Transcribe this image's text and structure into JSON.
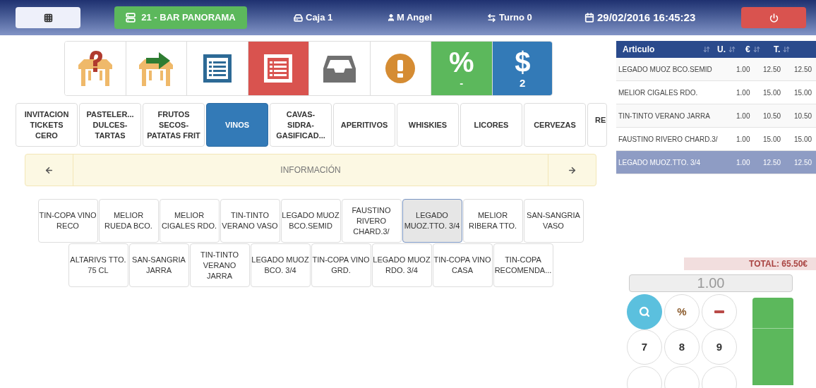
{
  "header": {
    "location": "21 - BAR PANORAMA",
    "register": "Caja 1",
    "user": "M Angel",
    "shift": "Turno 0",
    "datetime": "29/02/2016 16:45:23"
  },
  "toolbar": [
    {
      "kind": "table-question"
    },
    {
      "kind": "table-move"
    },
    {
      "kind": "list"
    },
    {
      "kind": "list-red"
    },
    {
      "kind": "tray"
    },
    {
      "kind": "warning"
    },
    {
      "kind": "discount",
      "label": "%",
      "caption": "-"
    },
    {
      "kind": "payment",
      "label": "$",
      "caption": "2"
    }
  ],
  "categories": [
    {
      "label": "INVITACION TICKETS CERO",
      "selected": false
    },
    {
      "label": "PASTELER... DULCES-TARTAS",
      "selected": false
    },
    {
      "label": "FRUTOS SECOS-PATATAS FRIT",
      "selected": false
    },
    {
      "label": "VINOS",
      "selected": true
    },
    {
      "label": "CAVAS-SIDRA-GASIFICAD...",
      "selected": false
    },
    {
      "label": "APERITIVOS",
      "selected": false
    },
    {
      "label": "WHISKIES",
      "selected": false
    },
    {
      "label": "LICORES",
      "selected": false
    },
    {
      "label": "CERVEZAS",
      "selected": false
    },
    {
      "label": "RE",
      "selected": false,
      "clipped": true
    }
  ],
  "info": {
    "label": "INFORMACIÓN"
  },
  "products": [
    [
      {
        "label": "TIN-COPA VINO RECO",
        "selected": false
      },
      {
        "label": "MELIOR RUEDA BCO.",
        "selected": false
      },
      {
        "label": "MELIOR CIGALES RDO.",
        "selected": false
      },
      {
        "label": "TIN-TINTO VERANO VASO",
        "selected": false
      },
      {
        "label": "LEGADO MUOZ BCO.SEMID",
        "selected": false
      },
      {
        "label": "FAUSTINO RIVERO CHARD.3/",
        "selected": false
      },
      {
        "label": "LEGADO MUOZ.TTO. 3/4",
        "selected": true
      },
      {
        "label": "MELIOR RIBERA TTO.",
        "selected": false
      },
      {
        "label": "SAN-SANGRIA VASO",
        "selected": false
      }
    ],
    [
      {
        "label": "ALTARIVS TTO. 75 CL",
        "selected": false
      },
      {
        "label": "SAN-SANGRIA JARRA",
        "selected": false
      },
      {
        "label": "TIN-TINTO VERANO JARRA",
        "selected": false
      },
      {
        "label": "LEGADO MUOZ BCO. 3/4",
        "selected": false
      },
      {
        "label": "TIN-COPA VINO GRD.",
        "selected": false
      },
      {
        "label": "LEGADO MUOZ RDO. 3/4",
        "selected": false
      },
      {
        "label": "TIN-COPA VINO CASA",
        "selected": false
      },
      {
        "label": "TIN-COPA RECOMENDA...",
        "selected": false
      }
    ]
  ],
  "ticket": {
    "columns": [
      "Articulo",
      "U.",
      "€",
      "T."
    ],
    "rows": [
      {
        "article": "LEGADO MUOZ BCO.SEMID",
        "units": "1.00",
        "price": "12.50",
        "total": "12.50",
        "selected": false
      },
      {
        "article": "MELIOR CIGALES RDO.",
        "units": "1.00",
        "price": "15.00",
        "total": "15.00",
        "selected": false
      },
      {
        "article": "TIN-TINTO VERANO JARRA",
        "units": "1.00",
        "price": "10.50",
        "total": "10.50",
        "selected": false
      },
      {
        "article": "FAUSTINO RIVERO CHARD.3/",
        "units": "1.00",
        "price": "15.00",
        "total": "15.00",
        "selected": false
      },
      {
        "article": "LEGADO MUOZ.TTO. 3/4",
        "units": "1.00",
        "price": "12.50",
        "total": "12.50",
        "selected": true
      }
    ]
  },
  "total": "TOTAL: 65.50€",
  "quantity": "1.00",
  "keypad": [
    {
      "kind": "search"
    },
    {
      "kind": "percent",
      "label": "%"
    },
    {
      "kind": "minus"
    },
    {
      "kind": "digit",
      "label": "7"
    },
    {
      "kind": "digit",
      "label": "8"
    },
    {
      "kind": "digit",
      "label": "9"
    }
  ]
}
